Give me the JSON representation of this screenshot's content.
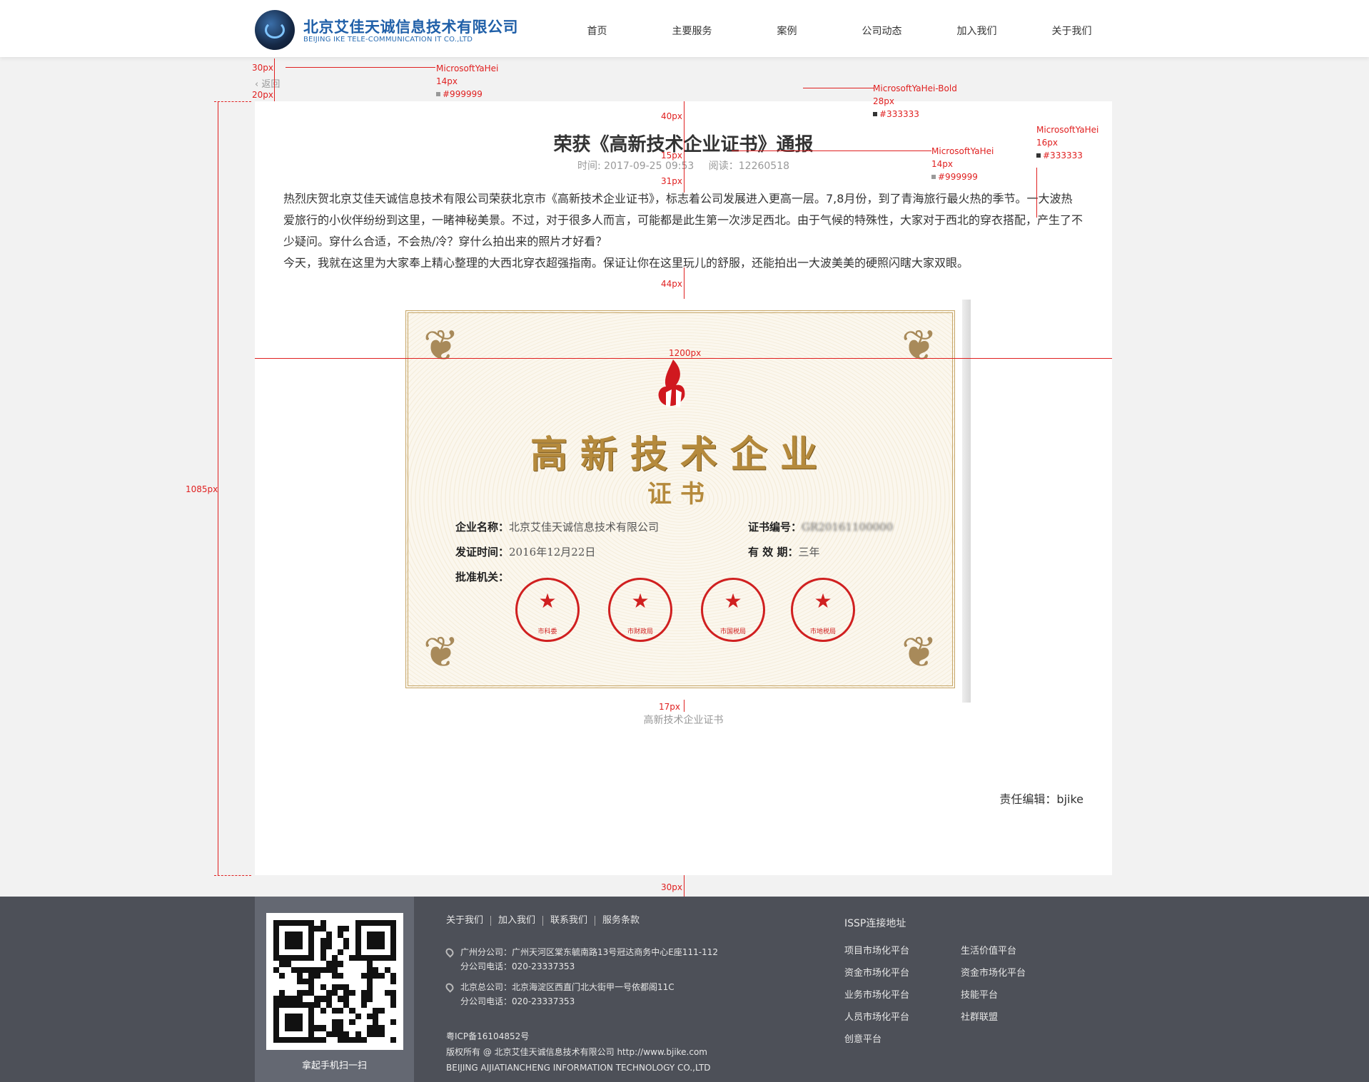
{
  "header": {
    "logo_cn": "北京艾佳天诚信息技术有限公司",
    "logo_en": "BEIJING IKE TELE-COMMUNICATION IT CO.,LTD",
    "nav": [
      "首页",
      "主要服务",
      "案例",
      "公司动态",
      "加入我们",
      "关于我们"
    ]
  },
  "back_label": "返回",
  "article": {
    "title": "荣获《高新技术企业证书》通报",
    "time": "时间: 2017-09-25 09:53",
    "reads": "阅读：12260518",
    "paragraphs": [
      "热烈庆贺北京艾佳天诚信息技术有限公司荣获北京市《高新技术企业证书》，标志着公司发展进入更高一层。7,8月份，到了青海旅行最火热的季节。一大波热爱旅行的小伙伴纷纷到这里，一睹神秘美景。不过，对于很多人而言，可能都是此生第一次涉足西北。由于气候的特殊性，大家对于西北的穿衣搭配，产生了不少疑问。穿什么合适，不会热/冷？穿什么拍出来的照片才好看？",
      "今天，我就在这里为大家奉上精心整理的大西北穿衣超强指南。保证让你在这里玩儿的舒服，还能拍出一大波美美的硬照闪瞎大家双眼。"
    ],
    "caption": "高新技术企业证书",
    "editor": "责任编辑：bjike"
  },
  "certificate": {
    "title": "高新技术企业",
    "subtitle": "证书",
    "company_label": "企业名称：",
    "company_value": "北京艾佳天诚信息技术有限公司",
    "cert_no_label": "证书编号：",
    "cert_no_value": "GR20161100000",
    "issue_label": "发证时间：",
    "issue_value": "2016年12月22日",
    "valid_label": "有 效 期：",
    "valid_value": "三年",
    "authority_label": "批准机关：",
    "seals": [
      "市科委",
      "市财政局",
      "市国税局",
      "市地税局"
    ]
  },
  "annotations": {
    "a30": "30px",
    "a20": "20px",
    "back_font": "MicrosoftYaHei",
    "back_size": "14px",
    "back_color": "#999999",
    "title_font": "MicrosoftYaHei-Bold",
    "title_size": "28px",
    "title_color": "#333333",
    "meta_font": "MicrosoftYaHei",
    "meta_size": "14px",
    "meta_color": "#999999",
    "body_font": "MicrosoftYaHei",
    "body_size": "16px",
    "body_color": "#333333",
    "a40": "40px",
    "a15": "15px",
    "a31": "31px",
    "a44": "44px",
    "a1200": "1200px",
    "a1085": "1085px",
    "a17": "17px",
    "a30b": "30px"
  },
  "footer": {
    "qr_caption": "拿起手机扫一扫",
    "links": [
      "关于我们",
      "加入我们",
      "联系我们",
      "服务条款"
    ],
    "gz_addr": "广州分公司：广州天河区棠东毓南路13号冠达商务中心E座111-112",
    "gz_tel": "分公司电话：020-23337353",
    "bj_addr": "北京总公司：北京海淀区西直门北大街甲一号依都阁11C",
    "bj_tel": "分公司电话：020-23337353",
    "icp": "粤ICP备16104852号",
    "copyright": "版权所有 @ 北京艾佳天诚信息技术有限公司 http://www.bjike.com",
    "company_en": "BEIJING AIJIATIANCHENG INFORMATION TECHNOLOGY CO.,LTD",
    "issp_title": "ISSP连接地址",
    "issp_links": [
      "项目市场化平台",
      "生活价值平台",
      "资金市场化平台",
      "资金市场化平台",
      "业务市场化平台",
      "技能平台",
      "人员市场化平台",
      "社群联盟",
      "创意平台"
    ]
  },
  "colors": {
    "accent_red": "#e02020",
    "footer_bg": "#4d5058",
    "logo_blue": "#1f5fa8"
  }
}
